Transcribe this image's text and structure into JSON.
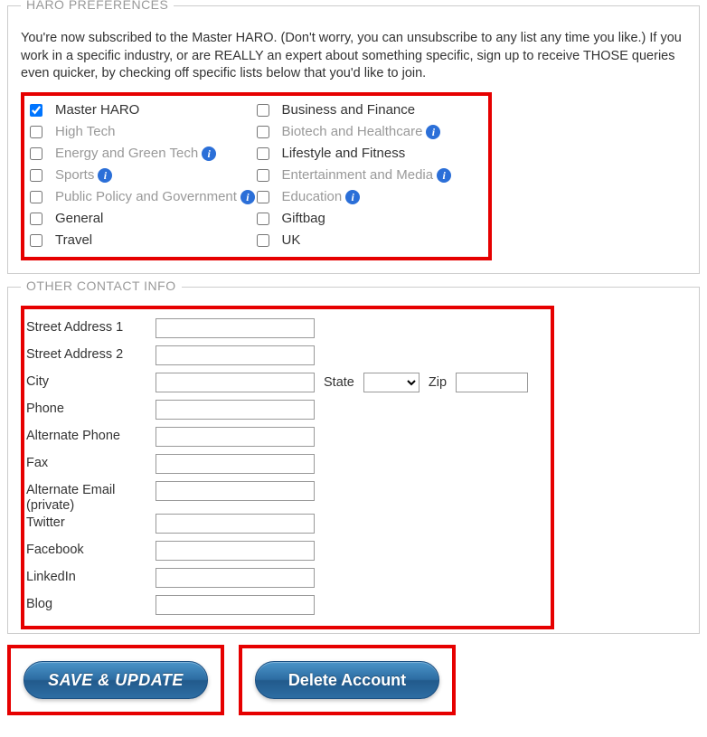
{
  "haro": {
    "legend": "HARO PREFERENCES",
    "intro": "You're now subscribed to the Master HARO. (Don't worry, you can unsubscribe to any list any time you like.) If you work in a specific industry, or are REALLY an expert about something specific, sign up to receive THOSE queries even quicker, by checking off specific lists below that you'd like to join.",
    "left": [
      {
        "label": "Master HARO",
        "checked": true,
        "muted": false,
        "info": false
      },
      {
        "label": "High Tech",
        "checked": false,
        "muted": true,
        "info": false
      },
      {
        "label": "Energy and Green Tech",
        "checked": false,
        "muted": true,
        "info": true
      },
      {
        "label": "Sports",
        "checked": false,
        "muted": true,
        "info": true
      },
      {
        "label": "Public Policy and Government",
        "checked": false,
        "muted": true,
        "info": true
      },
      {
        "label": "General",
        "checked": false,
        "muted": false,
        "info": false
      },
      {
        "label": "Travel",
        "checked": false,
        "muted": false,
        "info": false
      }
    ],
    "right": [
      {
        "label": "Business and Finance",
        "checked": false,
        "muted": false,
        "info": false
      },
      {
        "label": "Biotech and Healthcare",
        "checked": false,
        "muted": true,
        "info": true
      },
      {
        "label": "Lifestyle and Fitness",
        "checked": false,
        "muted": false,
        "info": false
      },
      {
        "label": "Entertainment and Media",
        "checked": false,
        "muted": true,
        "info": true
      },
      {
        "label": "Education",
        "checked": false,
        "muted": true,
        "info": true
      },
      {
        "label": "Giftbag",
        "checked": false,
        "muted": false,
        "info": false
      },
      {
        "label": "UK",
        "checked": false,
        "muted": false,
        "info": false
      }
    ]
  },
  "contact": {
    "legend": "OTHER CONTACT INFO",
    "fields": {
      "street1": {
        "label": "Street Address 1",
        "value": ""
      },
      "street2": {
        "label": "Street Address 2",
        "value": ""
      },
      "city": {
        "label": "City",
        "value": ""
      },
      "state": {
        "label": "State"
      },
      "zip": {
        "label": "Zip",
        "value": ""
      },
      "phone": {
        "label": "Phone",
        "value": ""
      },
      "altphone": {
        "label": "Alternate Phone",
        "value": ""
      },
      "fax": {
        "label": "Fax",
        "value": ""
      },
      "altemail": {
        "label": "Alternate Email (private)",
        "value": ""
      },
      "twitter": {
        "label": "Twitter",
        "value": ""
      },
      "facebook": {
        "label": "Facebook",
        "value": ""
      },
      "linkedin": {
        "label": "LinkedIn",
        "value": ""
      },
      "blog": {
        "label": "Blog",
        "value": ""
      }
    }
  },
  "buttons": {
    "save": "SAVE & UPDATE",
    "delete": "Delete Account"
  },
  "info_glyph": "i"
}
